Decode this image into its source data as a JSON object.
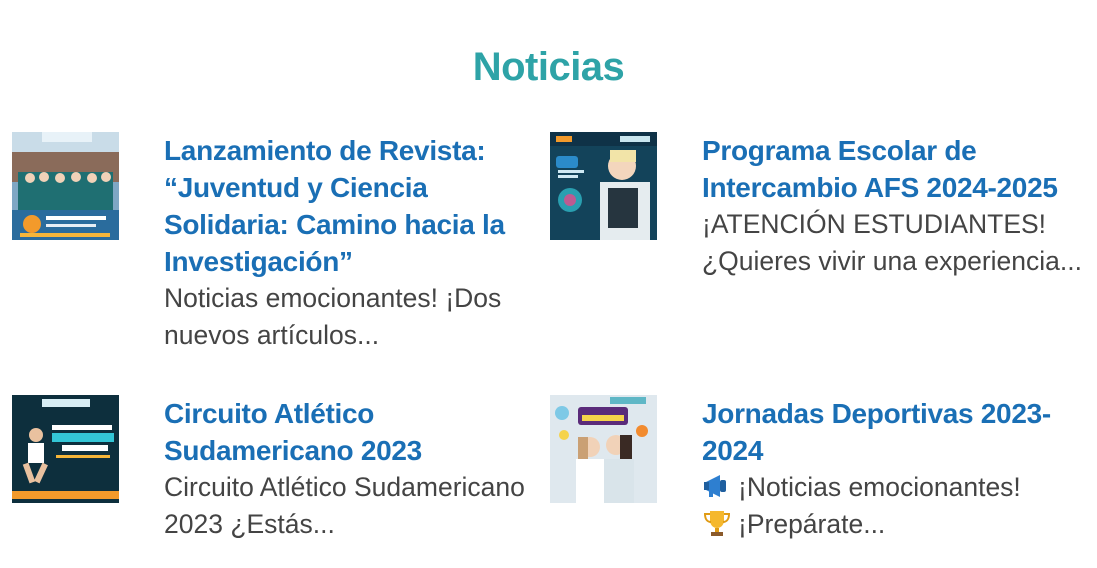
{
  "section": {
    "title": "Noticias"
  },
  "news": [
    {
      "title": "Lanzamiento de Revista: “Juventud y Ciencia Solidaria: Camino hacia la Investigación”",
      "excerpt": "Noticias emocionantes! ¡Dos nuevos artículos..."
    },
    {
      "title": "Programa Escolar de Intercambio AFS 2024-2025",
      "excerpt": "¡ATENCIÓN ESTUDIANTES!  ¿Quieres vivir una experiencia..."
    },
    {
      "title": "Circuito Atlético Sudamericano 2023",
      "excerpt": "Circuito Atlético Sudamericano 2023 ¿Estás..."
    },
    {
      "title": "Jornadas Deportivas 2023-2024",
      "excerpt_line1": "¡Noticias emocionantes!",
      "excerpt_line2": "¡Prepárate...",
      "icons": [
        "megaphone-icon",
        "trophy-icon"
      ]
    }
  ],
  "colors": {
    "section_title": "#2ea3a7",
    "item_title": "#1a6fb5",
    "excerpt": "#444444"
  }
}
